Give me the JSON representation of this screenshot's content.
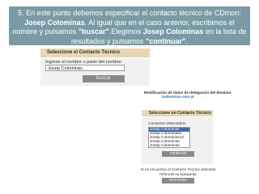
{
  "banner": {
    "part1": "5. En este punto debemos especificar el contacto técnico de CDmon: ",
    "bold1": "Josep Colominas",
    "part2": ". Al igual que en el caso anterior, escribimos el nombre y pulsamos ",
    "quoted1": "\"buscar\"",
    "part3": ".Elegimos ",
    "bold2": "Josep Colominas",
    "part4": " en la lista de resultados y pulsamos ",
    "quoted2": "\"continuar\"",
    "part5": "."
  },
  "search_panel": {
    "header": "Seleccione el Contacto Técnico",
    "label": "Ingrese el nombre o parte del nombre:",
    "input_value": "Josep Colominas",
    "button": "buscar"
  },
  "results_panel": {
    "title": "Modificación de datos de delegación del dominio:",
    "domain_link": "tudominio.com.ar",
    "header": "Seleccione un Contacto Técnico",
    "list_label": "Contactos detectados",
    "options": [
      "Josep Colominas",
      "Josep Colominas1",
      "Josep Colominas12",
      "Josep Colominas",
      "Josep Colominas"
    ],
    "selected_index": 0,
    "continue_button": "continuar",
    "note": "Si no encuentra el Contacto Técnico deseado refomule su búsqueda",
    "reformulate_button": "reformular"
  }
}
